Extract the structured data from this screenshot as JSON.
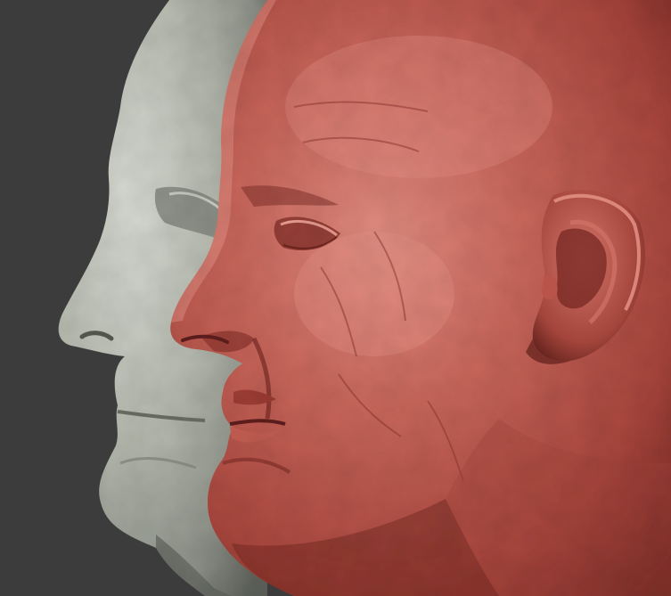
{
  "scene": {
    "background_color": "#3c3c3c",
    "models": [
      {
        "id": "gray-head-model",
        "material": "matcap-gray",
        "base_color": "#a3a79c",
        "highlight_color": "#d8dbd3",
        "shadow_color": "#5e625b",
        "orientation": "left-profile"
      },
      {
        "id": "red-head-model",
        "material": "matcap-red-wax",
        "base_color": "#b34a40",
        "highlight_color": "#e79a8d",
        "shadow_color": "#5e1f1b",
        "orientation": "left-profile"
      }
    ]
  }
}
